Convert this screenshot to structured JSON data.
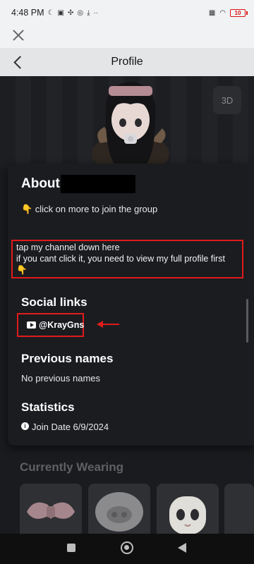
{
  "status_bar": {
    "time": "4:48 PM",
    "battery": "10"
  },
  "header": {
    "title": "Profile"
  },
  "avatar_view": {
    "mode_button": "3D"
  },
  "about": {
    "heading": "About",
    "line1": "👇 click on more to join the group",
    "box_line1": "tap my channel down here",
    "box_line2": "if you cant click it, you need to view my full profile first",
    "box_line3": "👇"
  },
  "social_links": {
    "heading": "Social links",
    "youtube_handle": "@KrayGns"
  },
  "previous_names": {
    "heading": "Previous names",
    "value": "No previous names"
  },
  "statistics": {
    "heading": "Statistics",
    "join_date": "Join Date 6/9/2024"
  },
  "currently_wearing": {
    "heading": "Currently Wearing"
  },
  "colors": {
    "annotation_red": "#e01b1b",
    "card_bg": "#1b1c20"
  }
}
